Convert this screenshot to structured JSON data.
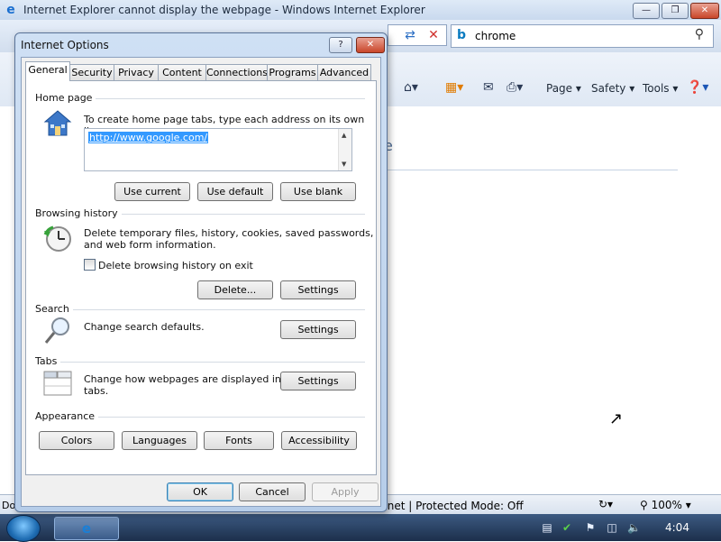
{
  "ie": {
    "title": "Internet Explorer cannot display the webpage - Windows Internet Explorer",
    "search_value": "chrome",
    "commands": {
      "page": "Page",
      "safety": "Safety",
      "tools": "Tools"
    },
    "page_heading_fragment": "e",
    "status_left": "Do",
    "status_zone": "rnet | Protected Mode: Off",
    "zoom": "100%"
  },
  "dialog": {
    "title": "Internet Options",
    "help_label": "?",
    "tabs": [
      {
        "label": "General"
      },
      {
        "label": "Security"
      },
      {
        "label": "Privacy"
      },
      {
        "label": "Content"
      },
      {
        "label": "Connections"
      },
      {
        "label": "Programs"
      },
      {
        "label": "Advanced"
      }
    ],
    "home_page": {
      "group_label": "Home page",
      "description": "To create home page tabs, type each address on its own line.",
      "url": "http://www.google.com/",
      "use_current": "Use current",
      "use_default": "Use default",
      "use_blank": "Use blank"
    },
    "browsing_history": {
      "group_label": "Browsing history",
      "description_line1": "Delete temporary files, history, cookies, saved passwords,",
      "description_line2": "and web form information.",
      "delete_on_exit_label": "Delete browsing history on exit",
      "delete_on_exit_checked": false,
      "delete_button": "Delete...",
      "settings_button": "Settings"
    },
    "search": {
      "group_label": "Search",
      "description": "Change search defaults.",
      "settings_button": "Settings"
    },
    "tabs_section": {
      "group_label": "Tabs",
      "description_line1": "Change how webpages are displayed in",
      "description_line2": "tabs.",
      "settings_button": "Settings"
    },
    "appearance": {
      "group_label": "Appearance",
      "colors": "Colors",
      "languages": "Languages",
      "fonts": "Fonts",
      "accessibility": "Accessibility"
    },
    "footer": {
      "ok": "OK",
      "cancel": "Cancel",
      "apply": "Apply"
    }
  },
  "taskbar": {
    "clock": "4:04"
  }
}
